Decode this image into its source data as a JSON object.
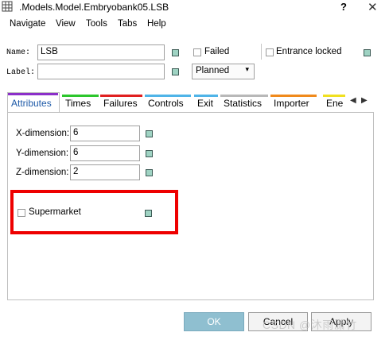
{
  "window": {
    "title": ".Models.Model.Embryobank05.LSB",
    "help_label": "?",
    "close_label": "✕"
  },
  "menu": [
    "Navigate",
    "View",
    "Tools",
    "Tabs",
    "Help"
  ],
  "header": {
    "name_label": "Name:",
    "name_value": "LSB",
    "label_label": "Label:",
    "label_value": "",
    "failed_label": "Failed",
    "entrance_locked_label": "Entrance locked",
    "status_selected": "Planned"
  },
  "tabs": [
    {
      "label": "Attributes",
      "color": "#8b2fc9",
      "active": true
    },
    {
      "label": "Times",
      "color": "#2cc62c"
    },
    {
      "label": "Failures",
      "color": "#e02020"
    },
    {
      "label": "Controls",
      "color": "#4fb4e8"
    },
    {
      "label": "Exit",
      "color": "#4fb4e8"
    },
    {
      "label": "Statistics",
      "color": "#b8b8b8"
    },
    {
      "label": "Importer",
      "color": "#f08a1c"
    },
    {
      "label": "Ene",
      "color": "#f0e020"
    }
  ],
  "attributes": {
    "x_label": "X-dimension:",
    "x_value": "6",
    "y_label": "Y-dimension:",
    "y_value": "6",
    "z_label": "Z-dimension:",
    "z_value": "2",
    "supermarket_label": "Supermarket"
  },
  "buttons": {
    "ok": "OK",
    "cancel": "Cancel",
    "apply": "Apply"
  },
  "watermark": "CSDN @沐雨潇竹",
  "colors": {
    "highlight_border": "#ee0000",
    "ok_button": "#8fbfd0",
    "indicator": "#9fd3c3"
  }
}
